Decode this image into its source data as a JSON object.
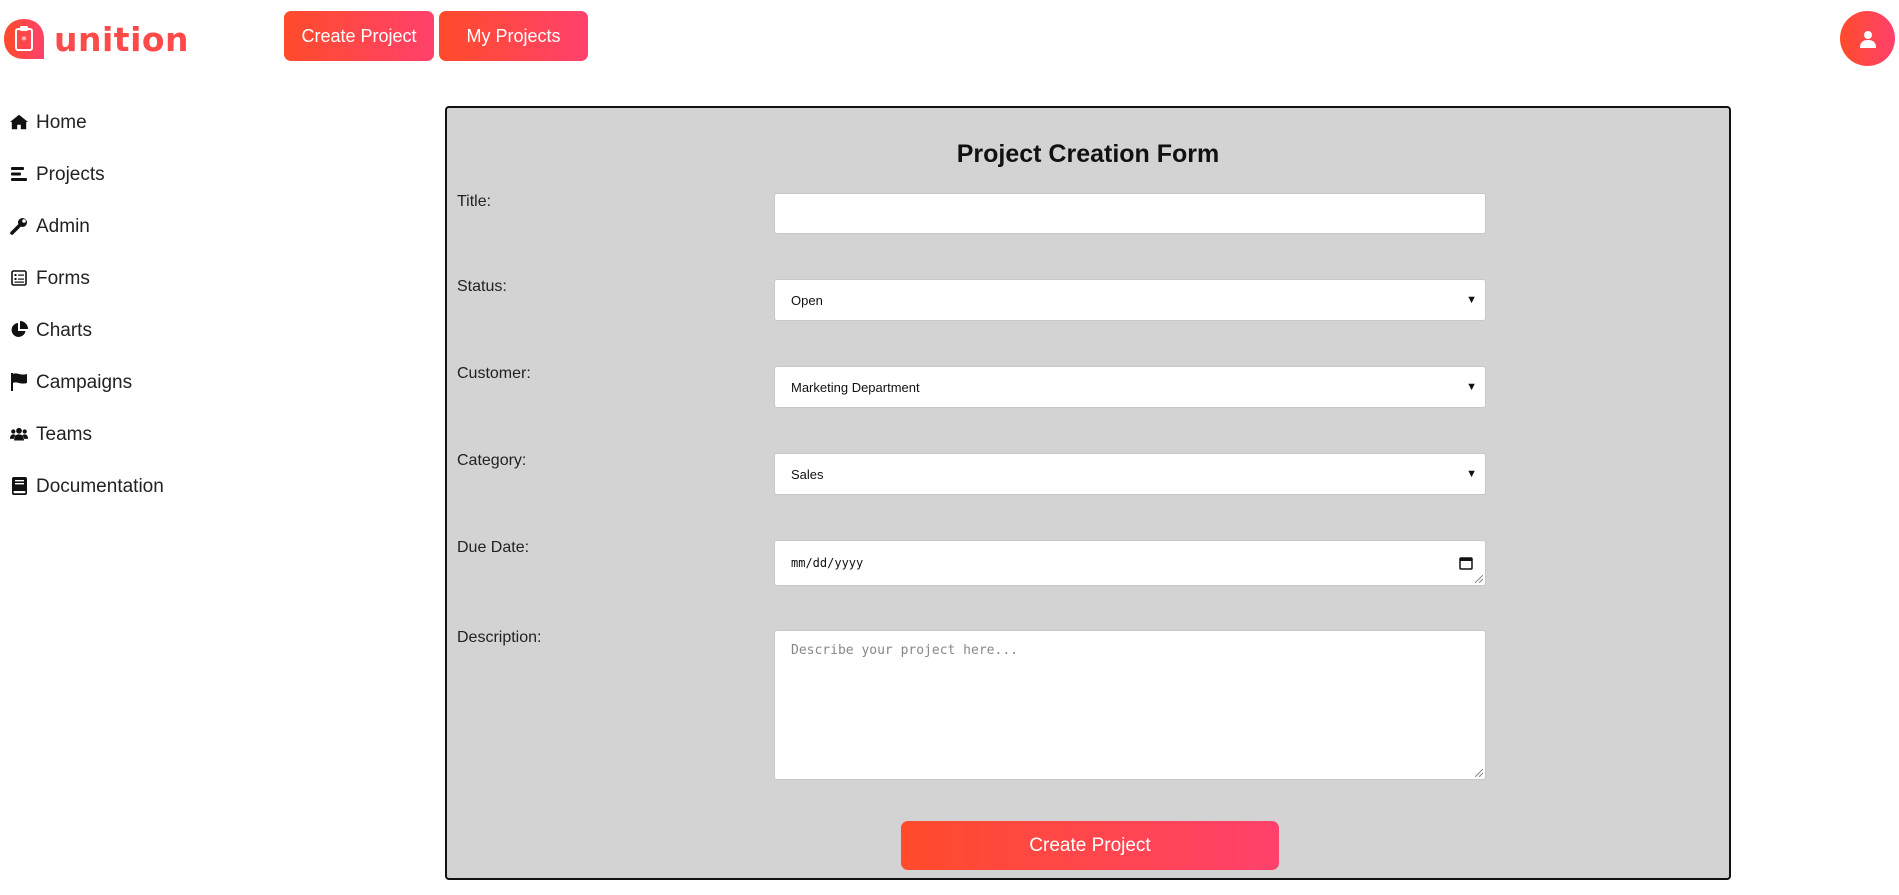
{
  "brand": {
    "name": "unition",
    "color": "#ff4a4a"
  },
  "top_actions": {
    "create_project_label": "Create Project",
    "my_projects_label": "My Projects"
  },
  "user": {
    "avatar_icon": "user-icon"
  },
  "sidebar": {
    "items": [
      {
        "label": "Home",
        "icon": "home-icon"
      },
      {
        "label": "Projects",
        "icon": "projects-icon"
      },
      {
        "label": "Admin",
        "icon": "wrench-icon"
      },
      {
        "label": "Forms",
        "icon": "form-icon"
      },
      {
        "label": "Charts",
        "icon": "pie-chart-icon"
      },
      {
        "label": "Campaigns",
        "icon": "flag-icon"
      },
      {
        "label": "Teams",
        "icon": "users-icon"
      },
      {
        "label": "Documentation",
        "icon": "book-icon"
      }
    ]
  },
  "form": {
    "title": "Project Creation Form",
    "title_field": {
      "label": "Title:",
      "value": ""
    },
    "status_field": {
      "label": "Status:",
      "value": "Open"
    },
    "customer_field": {
      "label": "Customer:",
      "value": "Marketing Department"
    },
    "category_field": {
      "label": "Category:",
      "value": "Sales"
    },
    "due_date_field": {
      "label": "Due Date:",
      "placeholder": "mm/dd/yyyy"
    },
    "description_field": {
      "label": "Description:",
      "placeholder": "Describe your project here..."
    },
    "submit_label": "Create Project"
  },
  "colors": {
    "accent_start": "#ff4b2b",
    "accent_end": "#ff416c",
    "form_bg": "#d3d3d3"
  }
}
